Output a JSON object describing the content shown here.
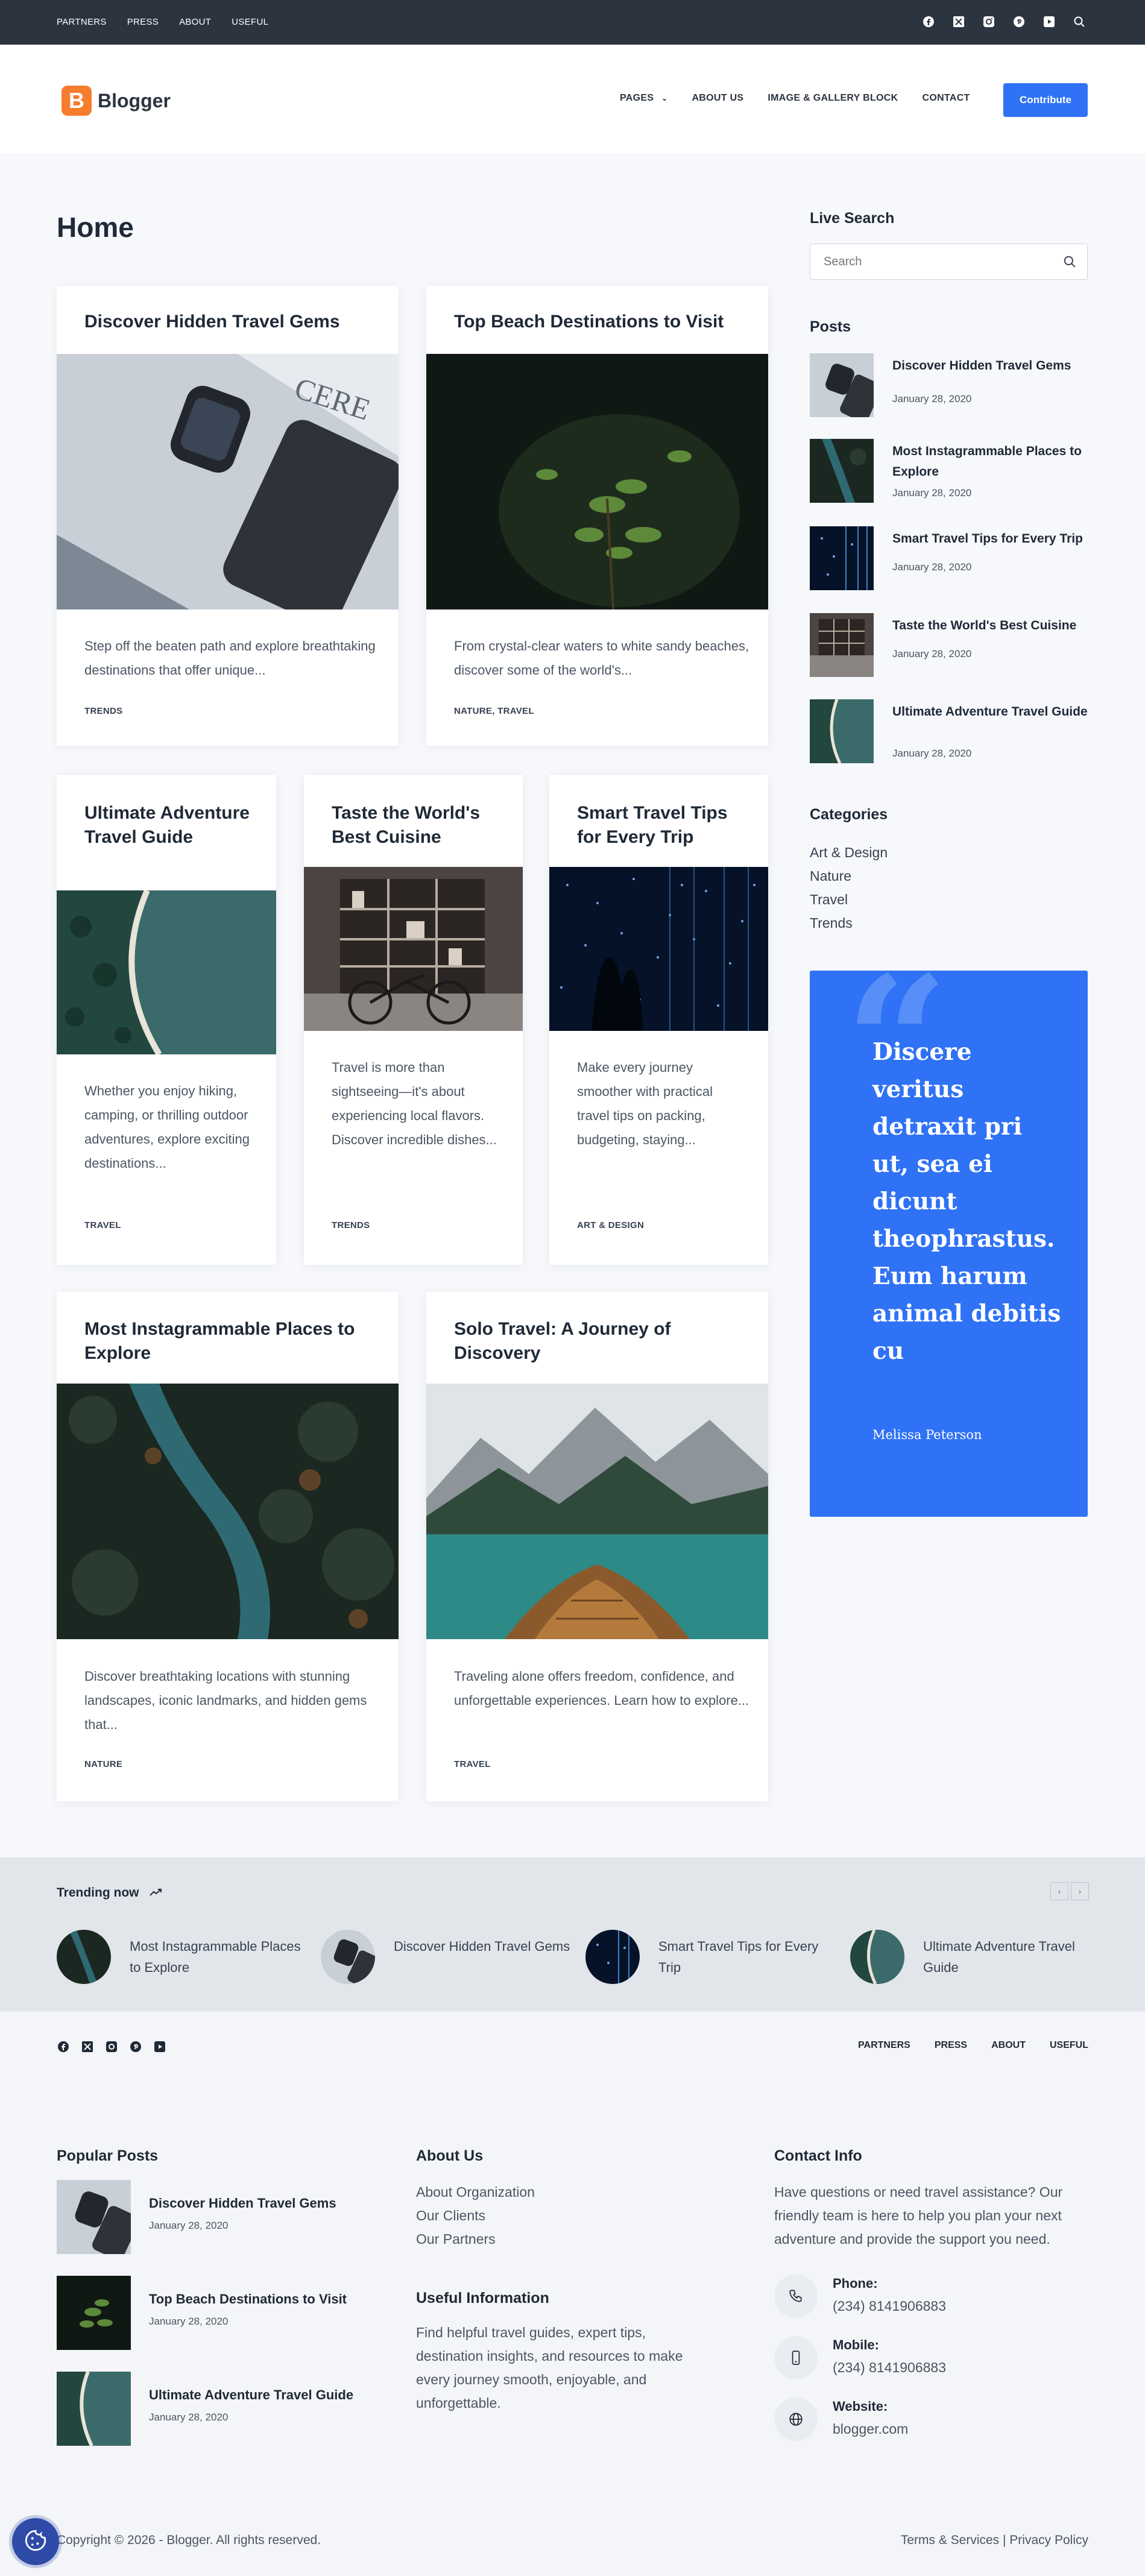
{
  "topbar": {
    "nav": [
      "PARTNERS",
      "PRESS",
      "ABOUT",
      "USEFUL"
    ],
    "icons": [
      "facebook-icon",
      "x-icon",
      "instagram-icon",
      "pinterest-icon",
      "youtube-icon",
      "search-icon"
    ]
  },
  "header": {
    "logo_mark": "B",
    "logo_text": "Blogger",
    "nav": [
      "PAGES",
      "ABOUT US",
      "IMAGE & GALLERY BLOCK",
      "CONTACT"
    ],
    "contribute": "Contribute"
  },
  "main": {
    "title": "Home",
    "cards": [
      {
        "title": "Discover Hidden Travel Gems",
        "excerpt": "Step off the beaten path and explore breathtaking destinations that offer unique...",
        "category": "TRENDS"
      },
      {
        "title": "Top Beach Destinations to Visit",
        "excerpt": "From crystal-clear waters to white sandy beaches, discover some of the world's...",
        "category": "NATURE, TRAVEL"
      },
      {
        "title": "Ultimate Adventure Travel Guide",
        "excerpt": "Whether you enjoy hiking, camping, or thrilling outdoor adventures, explore exciting destinations...",
        "category": "TRAVEL"
      },
      {
        "title": "Taste the World's Best Cuisine",
        "excerpt": "Travel is more than sightseeing—it's about experiencing local flavors. Discover incredible dishes...",
        "category": "TRENDS"
      },
      {
        "title": "Smart Travel Tips for Every Trip",
        "excerpt": "Make every journey smoother with practical travel tips on packing, budgeting, staying...",
        "category": "ART & DESIGN"
      },
      {
        "title": "Most Instagrammable Places to Explore",
        "excerpt": "Discover breathtaking locations with stunning landscapes, iconic landmarks, and hidden gems that...",
        "category": "NATURE"
      },
      {
        "title": "Solo Travel: A Journey of Discovery",
        "excerpt": "Traveling alone offers freedom, confidence, and unforgettable experiences. Learn how to explore...",
        "category": "TRAVEL"
      }
    ]
  },
  "sidebar": {
    "search_heading": "Live Search",
    "search_placeholder": "Search",
    "posts_heading": "Posts",
    "posts": [
      {
        "title": "Discover Hidden Travel Gems",
        "date": "January 28, 2020"
      },
      {
        "title": "Most Instagrammable Places to Explore",
        "date": "January 28, 2020"
      },
      {
        "title": "Smart Travel Tips for Every Trip",
        "date": "January 28, 2020"
      },
      {
        "title": "Taste the World's Best Cuisine",
        "date": "January 28, 2020"
      },
      {
        "title": "Ultimate Adventure Travel Guide",
        "date": "January 28, 2020"
      }
    ],
    "categories_heading": "Categories",
    "categories": [
      "Art & Design",
      "Nature",
      "Travel",
      "Trends"
    ],
    "quote": {
      "text": "Discere veritus detraxit pri ut, sea ei dicunt theophrastus. Eum harum animal debitis cu",
      "author": "Melissa Peterson"
    }
  },
  "trending": {
    "heading": "Trending now",
    "items": [
      "Most Instagrammable Places to Explore",
      "Discover Hidden Travel Gems",
      "Smart Travel Tips for Every Trip",
      "Ultimate Adventure Travel Guide"
    ]
  },
  "footer": {
    "social": [
      "facebook-icon",
      "x-icon",
      "instagram-icon",
      "pinterest-icon",
      "youtube-icon"
    ],
    "nav": [
      "PARTNERS",
      "PRESS",
      "ABOUT",
      "USEFUL"
    ],
    "popular_heading": "Popular Posts",
    "popular": [
      {
        "title": "Discover Hidden Travel Gems",
        "date": "January 28, 2020"
      },
      {
        "title": "Top Beach Destinations to Visit",
        "date": "January 28, 2020"
      },
      {
        "title": "Ultimate Adventure Travel Guide",
        "date": "January 28, 2020"
      }
    ],
    "about_heading": "About Us",
    "about_links": [
      "About Organization",
      "Our Clients",
      "Our Partners"
    ],
    "useful_heading": "Useful Information",
    "useful_text": "Find helpful travel guides, expert tips, destination insights, and resources to make every journey smooth, enjoyable, and unforgettable.",
    "contact_heading": "Contact Info",
    "contact_text": "Have questions or need travel assistance? Our friendly team is here to help you plan your next adventure and provide the support you need.",
    "contacts": [
      {
        "label": "Phone:",
        "value": "(234) 8141906883"
      },
      {
        "label": "Mobile:",
        "value": "(234) 8141906883"
      },
      {
        "label": "Website:",
        "value": "blogger.com"
      }
    ],
    "copyright": "Copyright © 2026 - Blogger. All rights reserved.",
    "legal": "Terms & Services | Privacy Policy"
  }
}
